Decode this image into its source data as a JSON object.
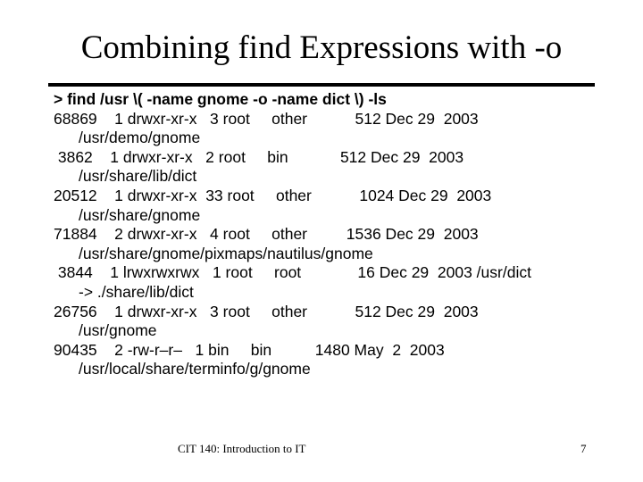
{
  "slide": {
    "title": "Combining find Expressions with -o",
    "command": "> find /usr \\( -name gnome -o -name dict \\) -ls",
    "entries": [
      {
        "line1": "68869    1 drwxr-xr-x   3 root     other           512 Dec 29  2003",
        "line2": "/usr/demo/gnome"
      },
      {
        "line1": " 3862    1 drwxr-xr-x   2 root     bin            512 Dec 29  2003",
        "line2": "/usr/share/lib/dict"
      },
      {
        "line1": "20512    1 drwxr-xr-x  33 root     other           1024 Dec 29  2003",
        "line2": "/usr/share/gnome"
      },
      {
        "line1": "71884    2 drwxr-xr-x   4 root     other         1536 Dec 29  2003",
        "line2": "/usr/share/gnome/pixmaps/nautilus/gnome"
      },
      {
        "line1": " 3844    1 lrwxrwxrwx   1 root     root             16 Dec 29  2003 /usr/dict",
        "line2": "-> ./share/lib/dict"
      },
      {
        "line1": "26756    1 drwxr-xr-x   3 root     other           512 Dec 29  2003",
        "line2": "/usr/gnome"
      },
      {
        "line1": "90435    2 -rw-r–r–   1 bin     bin          1480 May  2  2003",
        "line2": "/usr/local/share/terminfo/g/gnome"
      }
    ],
    "footer": {
      "course": "CIT 140: Introduction to IT",
      "page_number": "7"
    }
  }
}
